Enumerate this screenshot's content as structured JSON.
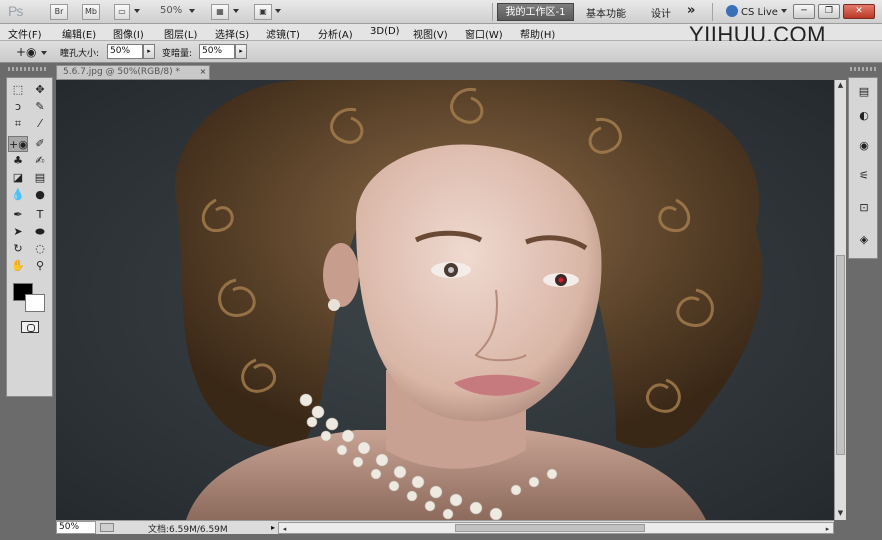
{
  "app": {
    "logo": "Ps",
    "bridge_btn": "Br",
    "minibridge_btn": "Mb",
    "zoom_level": "50%",
    "workspaces": [
      "我的工作区-1",
      "基本功能",
      "设计"
    ],
    "more_workspaces": "»",
    "cs_live": "CS Live",
    "window_minimize": "─",
    "window_restore": "❐",
    "window_close": "✕"
  },
  "watermark": "YIIHUU.COM",
  "menu": [
    "文件(F)",
    "编辑(E)",
    "图像(I)",
    "图层(L)",
    "选择(S)",
    "滤镜(T)",
    "分析(A)",
    "3D(D)",
    "视图(V)",
    "窗口(W)",
    "帮助(H)"
  ],
  "options": {
    "tool_preset_icon": "sponge-brush-icon",
    "size_label": "瞳孔大小:",
    "size_value": "50%",
    "darken_label": "变暗量:",
    "darken_value": "50%",
    "stepper_glyph": "▸"
  },
  "document": {
    "tab_title": "5.6.7.jpg @ 50%(RGB/8) *",
    "tab_close": "×",
    "zoom": "50%",
    "doc_info": "文档:6.59M/6.59M"
  },
  "colors": {
    "foreground": "#000000",
    "background": "#ffffff",
    "workspace_active": "#5f5f5f",
    "canvas_backdrop": "#2f3539"
  }
}
